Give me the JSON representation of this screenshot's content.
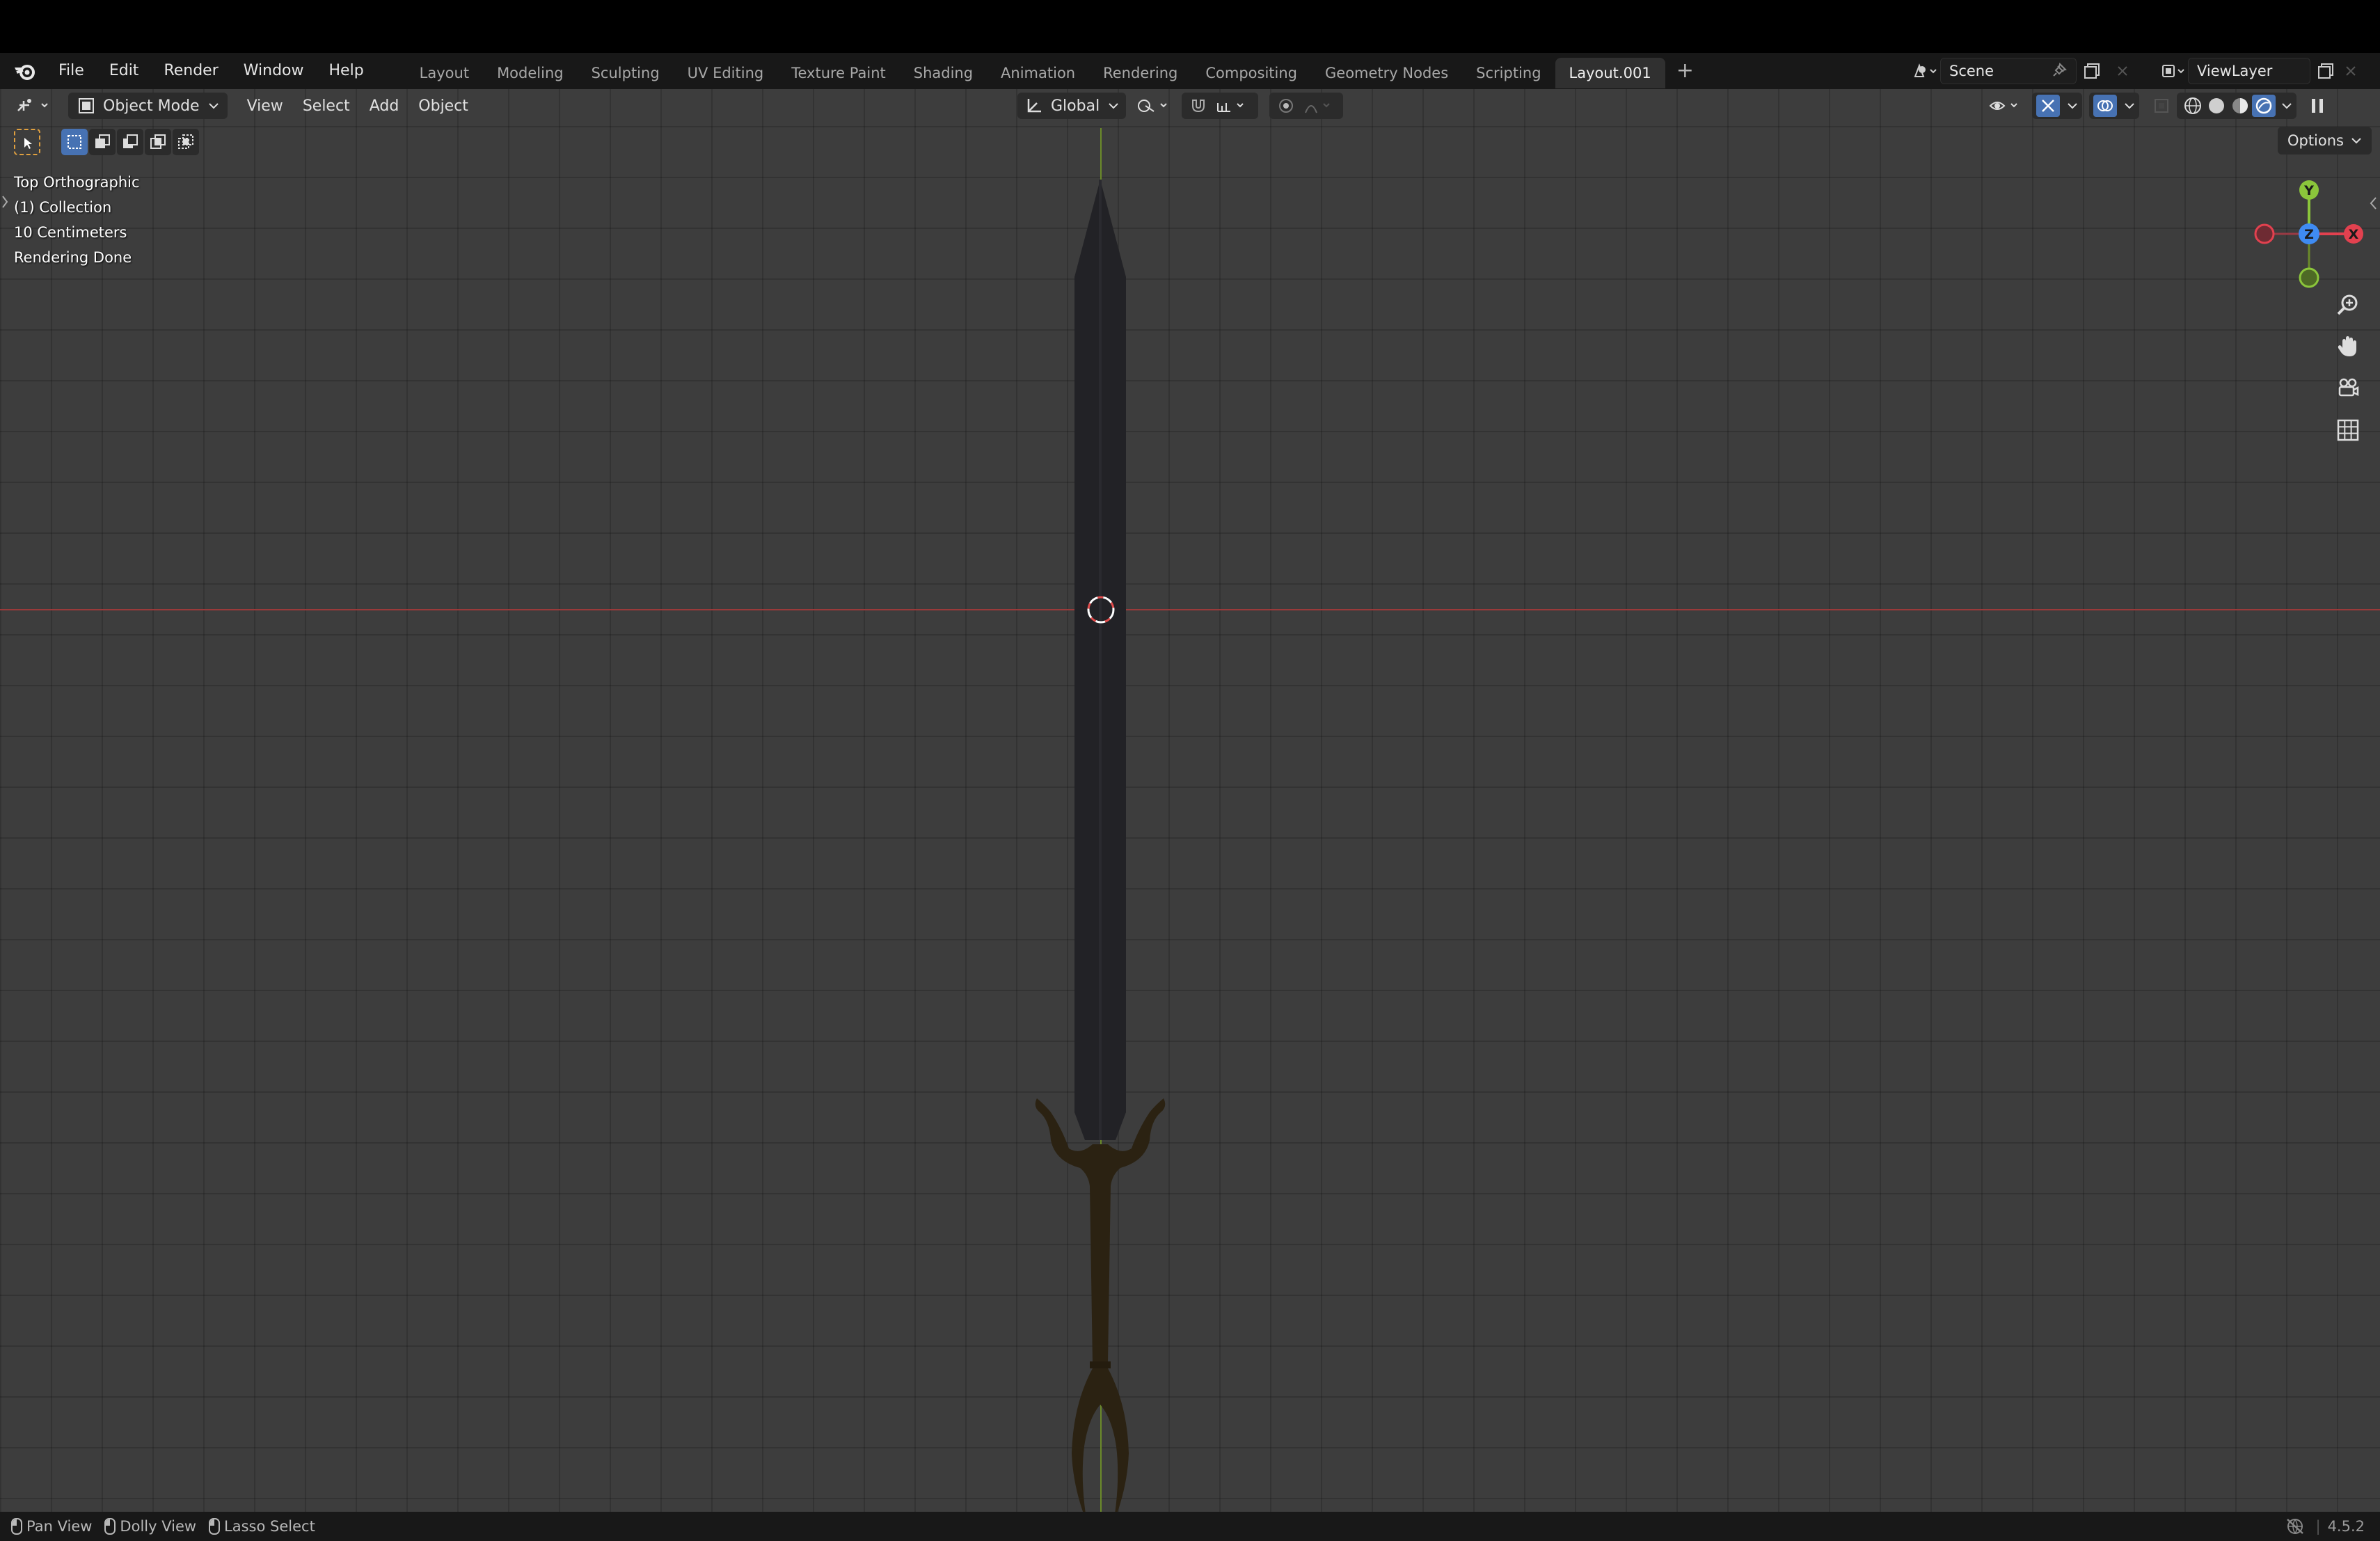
{
  "menu": {
    "items": [
      "File",
      "Edit",
      "Render",
      "Window",
      "Help"
    ]
  },
  "workspaces": {
    "tabs": [
      "Layout",
      "Modeling",
      "Sculpting",
      "UV Editing",
      "Texture Paint",
      "Shading",
      "Animation",
      "Rendering",
      "Compositing",
      "Geometry Nodes",
      "Scripting",
      "Layout.001"
    ],
    "active": "Layout.001",
    "add_label": "+"
  },
  "scene": {
    "name": "Scene"
  },
  "view_layer": {
    "name": "ViewLayer"
  },
  "viewport_header": {
    "mode": "Object Mode",
    "menus": [
      "View",
      "Select",
      "Add",
      "Object"
    ],
    "transform_orientation": "Global",
    "options_label": "Options"
  },
  "overlay": {
    "view_name": "Top Orthographic",
    "collection": "(1) Collection",
    "grid_scale": "10 Centimeters",
    "status": "Rendering Done"
  },
  "gizmo": {
    "y": "Y",
    "x": "X",
    "z": "Z"
  },
  "statusbar": {
    "pan": "Pan View",
    "dolly": "Dolly View",
    "lasso": "Lasso Select",
    "version": "4.5.2"
  },
  "colors": {
    "accent": "#4772b3",
    "x_axis": "#e2414f",
    "y_axis": "#8bc63b",
    "z_axis": "#3f8bf2",
    "blade": "#222226",
    "hilt": "#2b2212"
  }
}
